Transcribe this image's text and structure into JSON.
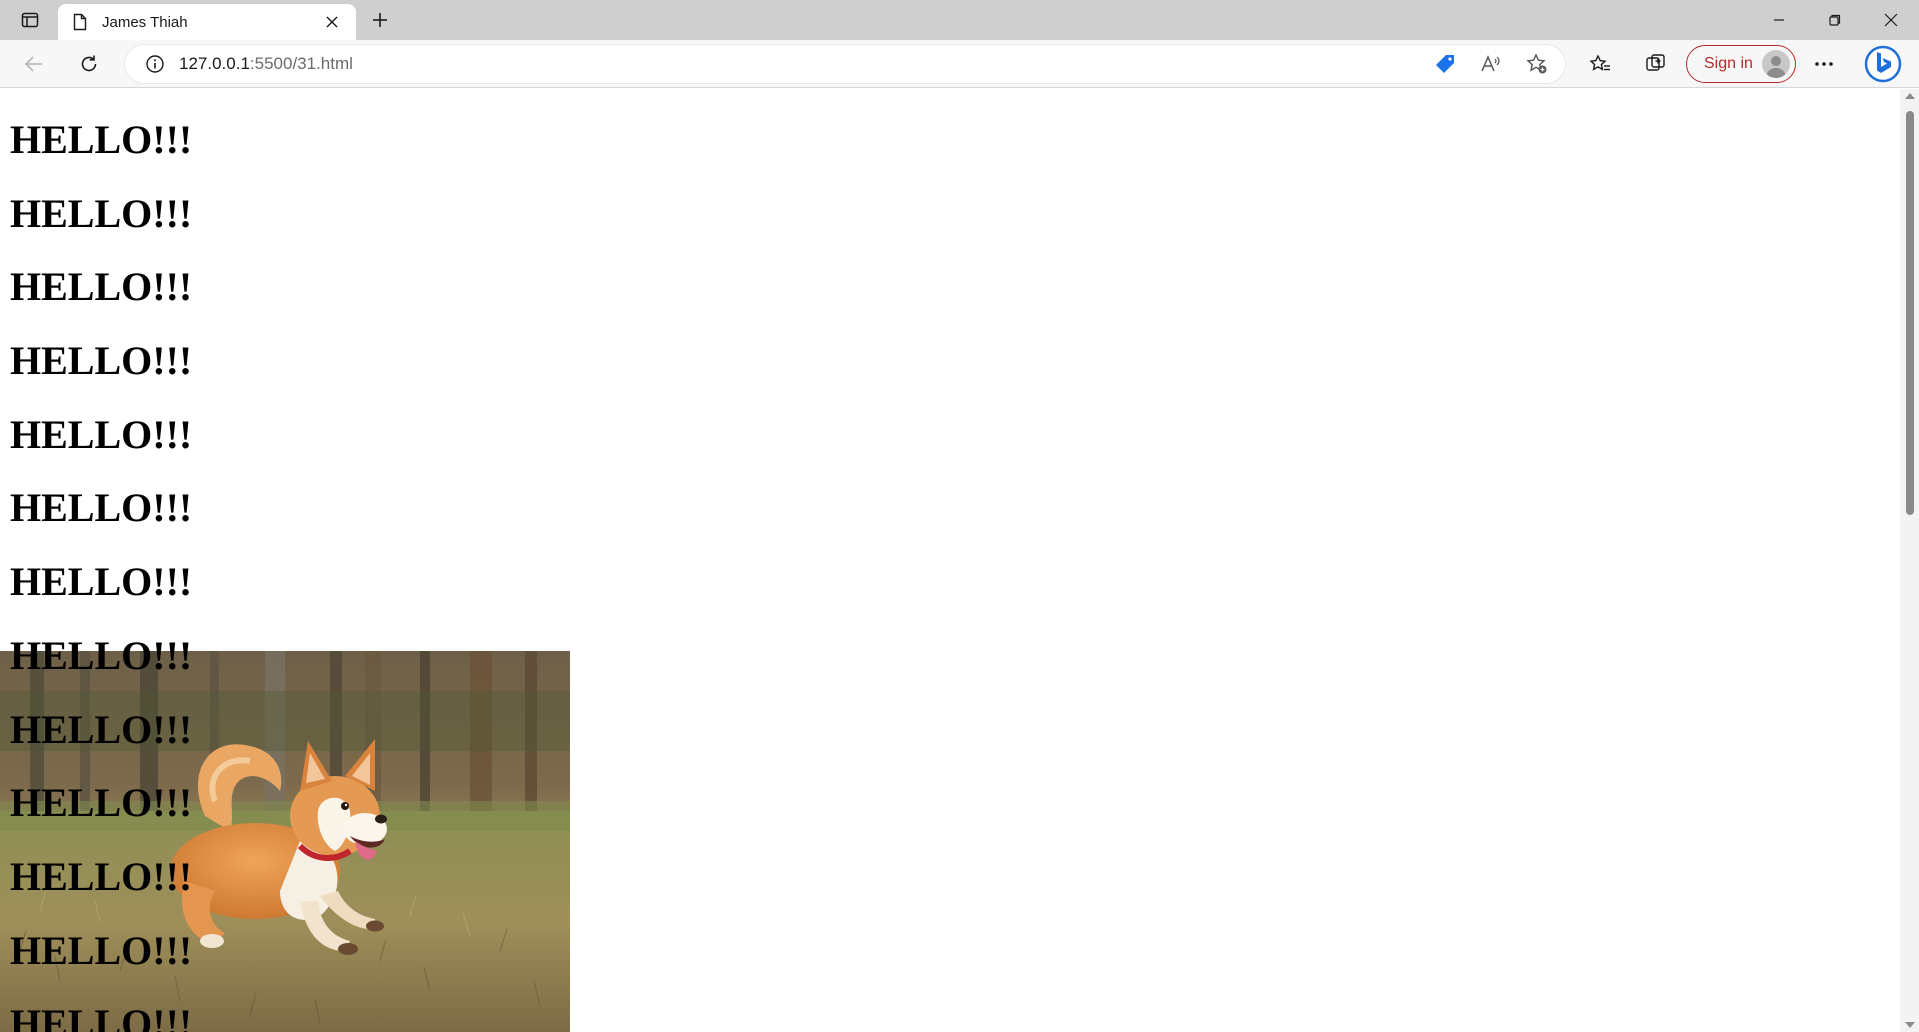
{
  "browser": {
    "tab": {
      "title": "James Thiah",
      "favicon": "document-icon"
    },
    "address": {
      "host": "127.0.0.1",
      "path": ":5500/31.html"
    },
    "toolbar": {
      "signin_label": "Sign in"
    },
    "colors": {
      "signin_accent": "#b42b2b",
      "tabstrip": "#cfcfcf",
      "toolbar": "#f7f7f7",
      "coupon_accent": "#1a73e8"
    }
  },
  "page": {
    "headings": [
      "HELLO!!!",
      "HELLO!!!",
      "HELLO!!!",
      "HELLO!!!",
      "HELLO!!!",
      "HELLO!!!",
      "HELLO!!!",
      "HELLO!!!",
      "HELLO!!!",
      "HELLO!!!",
      "HELLO!!!",
      "HELLO!!!",
      "HELLO!!!"
    ],
    "image": {
      "subject": "corgi running in grass field"
    }
  }
}
